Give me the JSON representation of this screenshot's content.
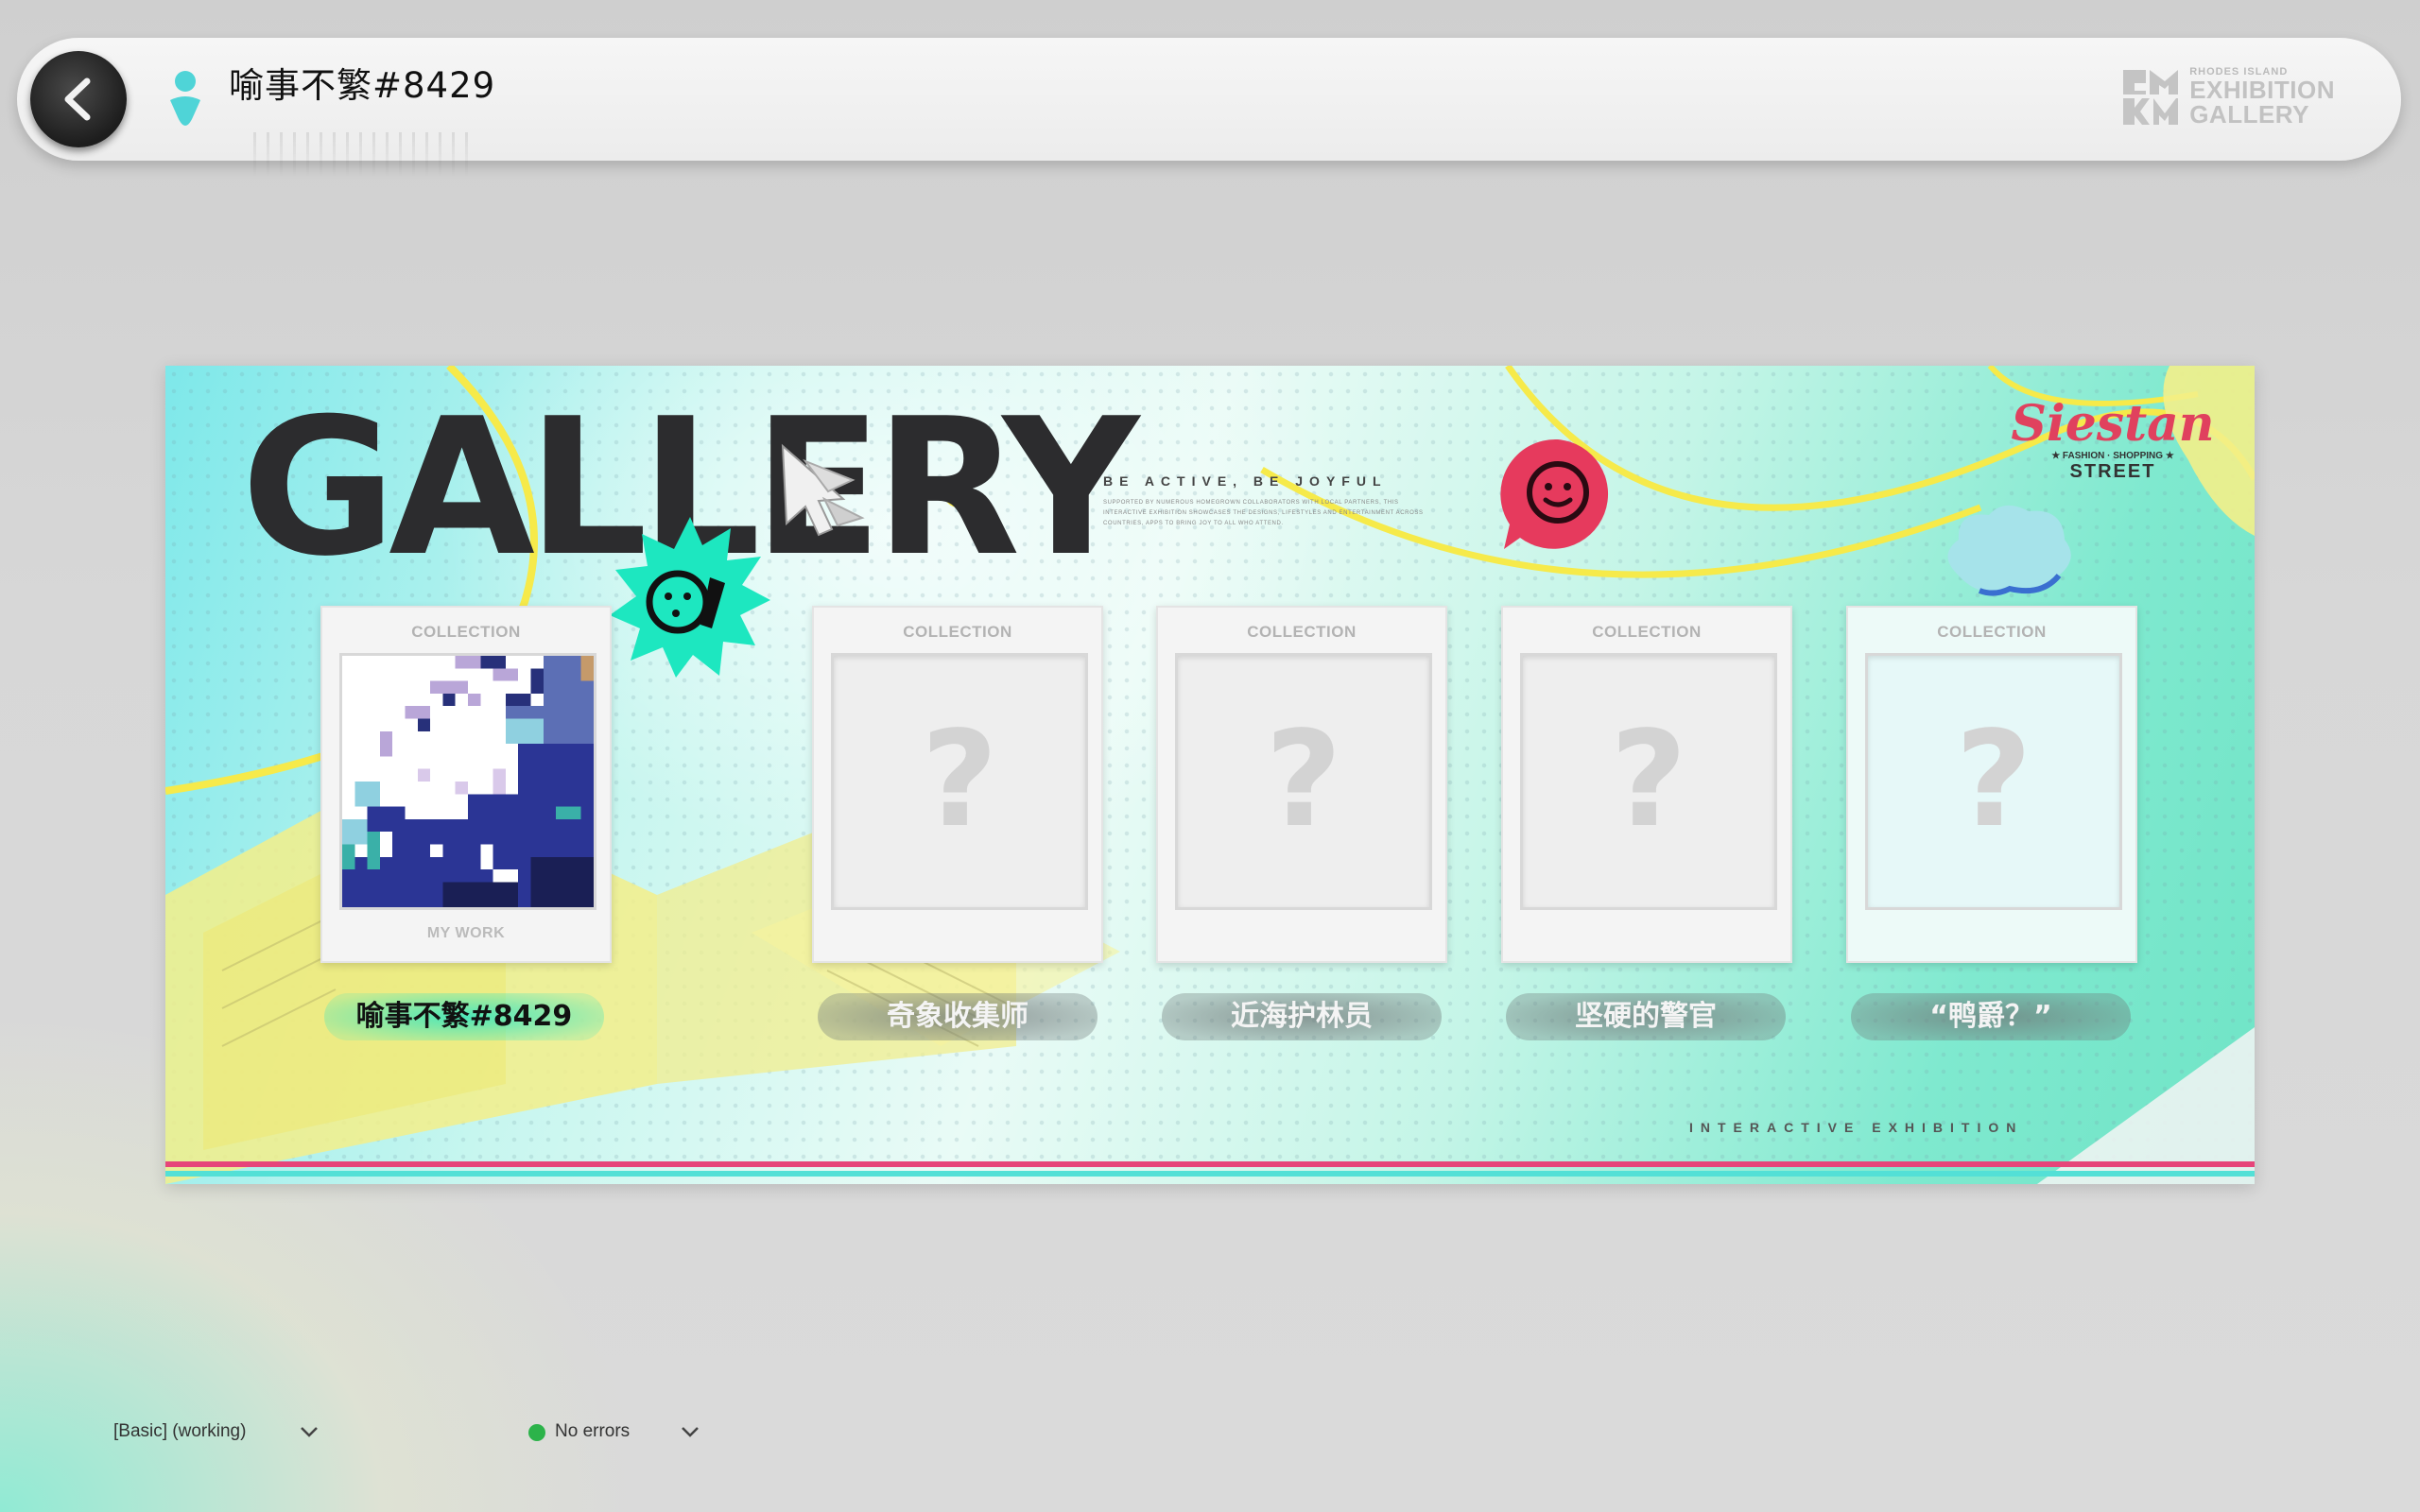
{
  "header": {
    "back_icon": "chevron-left-icon",
    "user_icon": "person-icon",
    "player_name": "喻事不繁#8429",
    "brand_small": "RHODES ISLAND",
    "brand_line1": "EXHIBITION",
    "brand_line2": "GALLERY"
  },
  "banner": {
    "title": "GALLERY",
    "tagline": "BE ACTIVE, BE JOYFUL",
    "fineprint": "SUPPORTED BY NUMEROUS HOMEGROWN COLLABORATORS WITH LOCAL PARTNERS, THIS INTERACTIVE EXHIBITION SHOWCASES THE DESIGNS, LIFESTYLES AND ENTERTAINMENT ACROSS COUNTRIES, APPS TO BRING JOY TO ALL WHO ATTEND.",
    "partner_logo": "Siestan",
    "partner_sub": "★ FASHION · SHOPPING ★",
    "partner_street": "STREET",
    "footer_text": "INTERACTIVE EXHIBITION",
    "colors": {
      "accent_pink": "#e6457a",
      "accent_teal": "#53e0d6",
      "bubble_red": "#e63a5d"
    }
  },
  "cards": [
    {
      "header": "COLLECTION",
      "footer": "MY WORK",
      "label": "喻事不繁#8429",
      "state": "unlocked"
    },
    {
      "header": "COLLECTION",
      "footer": "",
      "label": "奇象收集师",
      "state": "locked"
    },
    {
      "header": "COLLECTION",
      "footer": "",
      "label": "近海护林员",
      "state": "locked"
    },
    {
      "header": "COLLECTION",
      "footer": "",
      "label": "坚硬的警官",
      "state": "locked"
    },
    {
      "header": "COLLECTION",
      "footer": "",
      "label": "“鸭爵？”",
      "state": "locked"
    }
  ],
  "locked_glyph": "?",
  "status_bar": {
    "profile": "[Basic] (working)",
    "errors": "No errors"
  }
}
